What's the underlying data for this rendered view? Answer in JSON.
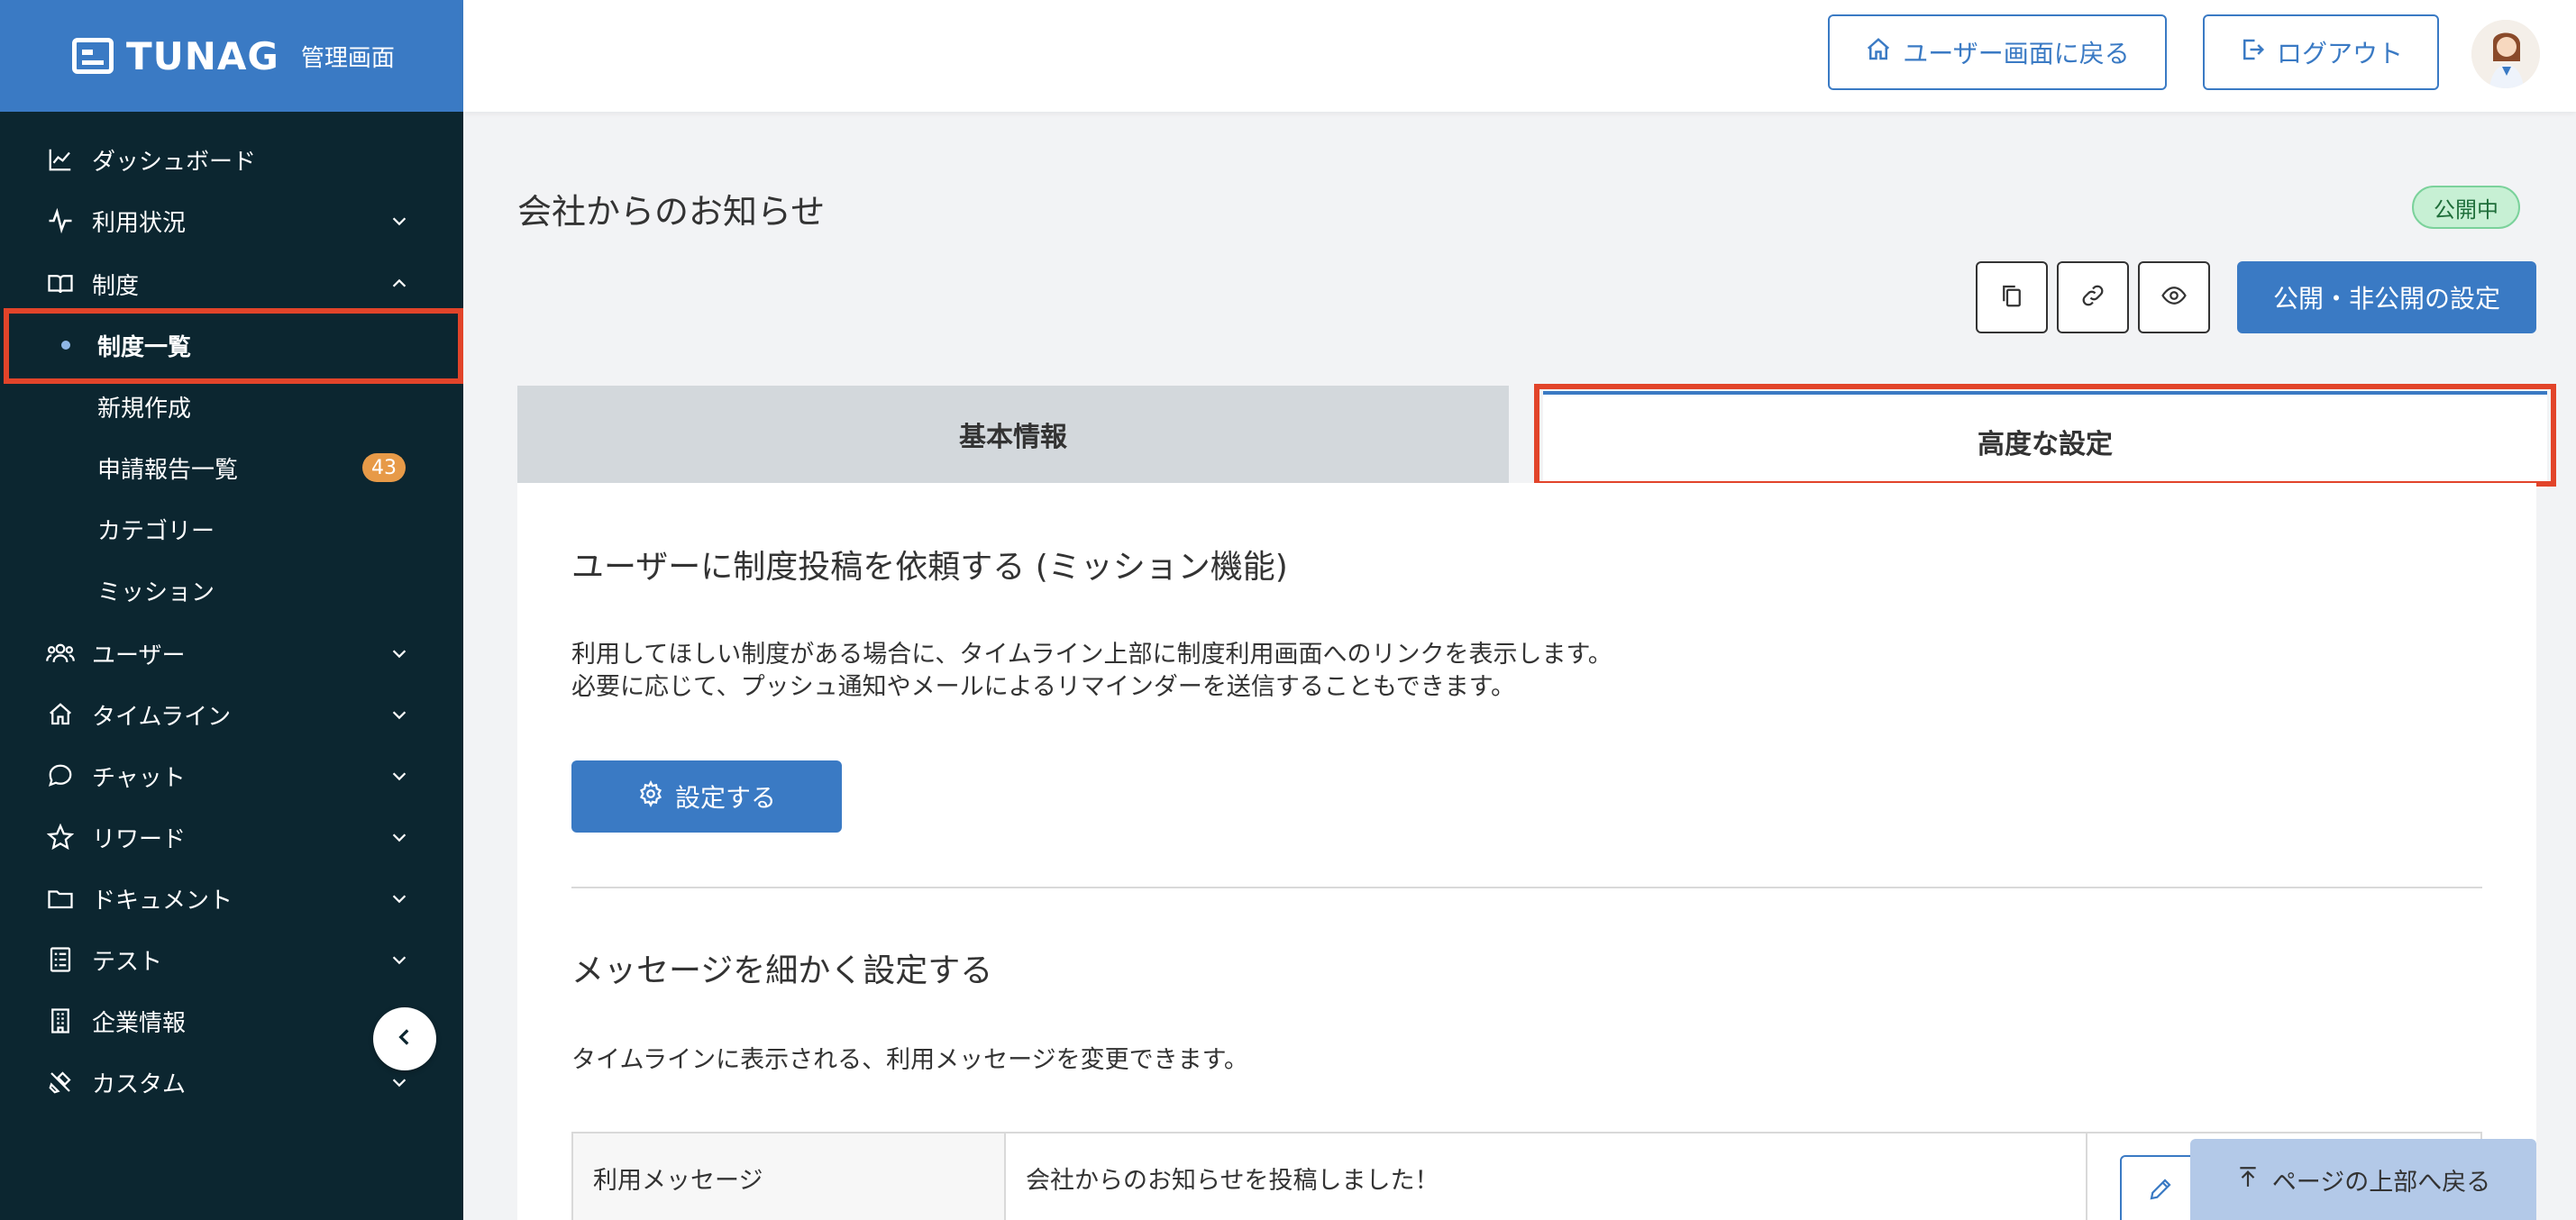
{
  "app": {
    "logo": "TUNAG",
    "subtitle": "管理画面"
  },
  "header": {
    "user_screen_button": "ユーザー画面に戻る",
    "logout_button": "ログアウト"
  },
  "sidebar": {
    "items": [
      {
        "label": "ダッシュボード",
        "icon": "chart-icon"
      },
      {
        "label": "利用状況",
        "icon": "activity-icon"
      },
      {
        "label": "制度",
        "icon": "book-icon"
      },
      {
        "label": "ユーザー",
        "icon": "users-icon"
      },
      {
        "label": "タイムライン",
        "icon": "home-icon"
      },
      {
        "label": "チャット",
        "icon": "chat-icon"
      },
      {
        "label": "リワード",
        "icon": "star-icon"
      },
      {
        "label": "ドキュメント",
        "icon": "folder-icon"
      },
      {
        "label": "テスト",
        "icon": "checklist-icon"
      },
      {
        "label": "企業情報",
        "icon": "building-icon"
      },
      {
        "label": "カスタム",
        "icon": "tools-icon"
      }
    ],
    "sub_items": [
      {
        "label": "制度一覧"
      },
      {
        "label": "新規作成"
      },
      {
        "label": "申請報告一覧",
        "badge": "43"
      },
      {
        "label": "カテゴリー"
      },
      {
        "label": "ミッション"
      }
    ]
  },
  "main": {
    "title": "会社からのお知らせ",
    "status": "公開中",
    "publish_button": "公開・非公開の設定",
    "tabs": [
      {
        "label": "基本情報"
      },
      {
        "label": "高度な設定"
      }
    ],
    "mission_section": {
      "title": "ユーザーに制度投稿を依頼する (ミッション機能)",
      "line1": "利用してほしい制度がある場合に、タイムライン上部に制度利用画面へのリンクを表示します。",
      "line2": "必要に応じて、プッシュ通知やメールによるリマインダーを送信することもできます。",
      "button": "設定する"
    },
    "message_section": {
      "title": "メッセージを細かく設定する",
      "description": "タイムラインに表示される、利用メッセージを変更できます。",
      "row_label": "利用メッセージ",
      "row_value": "会社からのお知らせを投稿しました！"
    },
    "back_to_top": "ページの上部へ戻る"
  }
}
